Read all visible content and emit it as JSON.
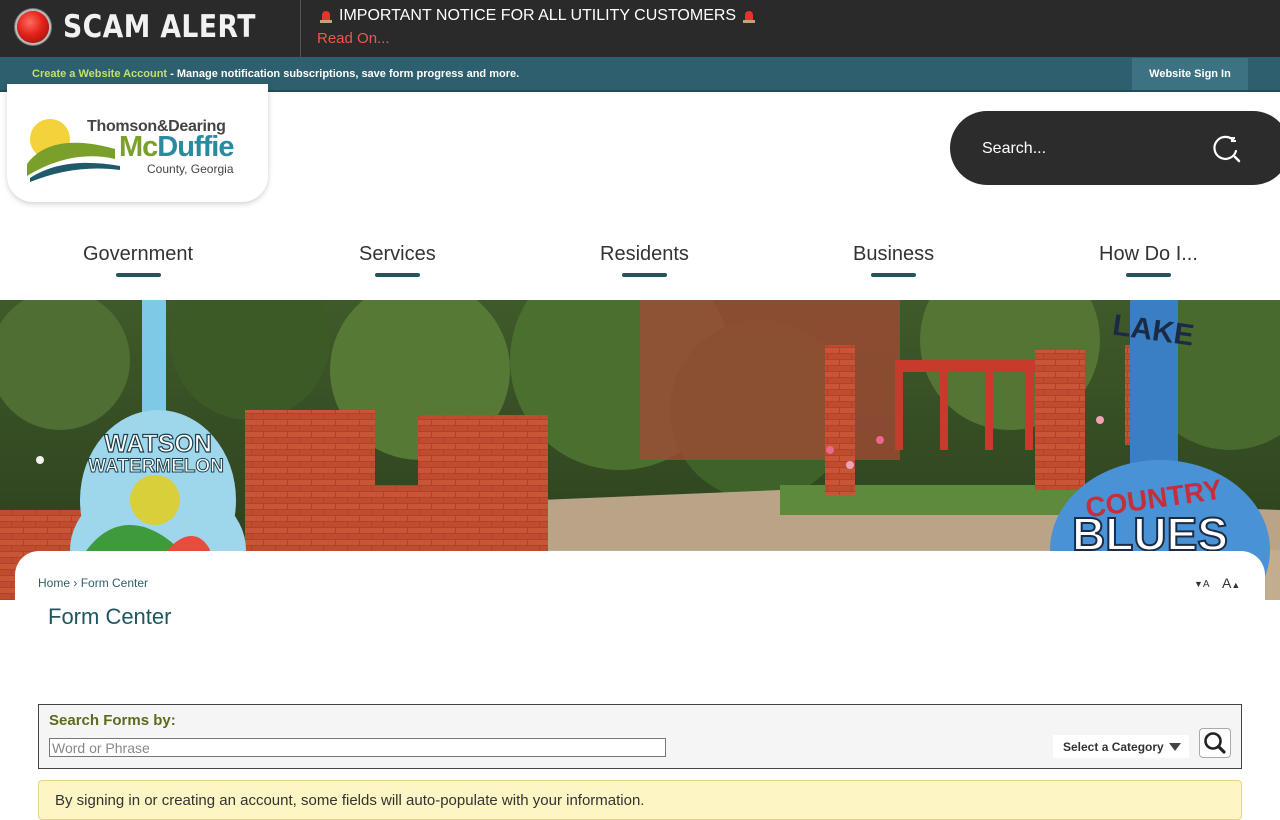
{
  "alert": {
    "title": "SCAM ALERT",
    "notice": "IMPORTANT NOTICE FOR ALL UTILITY CUSTOMERS",
    "read_on": "Read On..."
  },
  "account_bar": {
    "link": "Create a Website Account",
    "text": " - Manage notification subscriptions, save form progress and more.",
    "signin": "Website Sign In"
  },
  "logo": {
    "line1": "Thomson&Dearing",
    "line2_mc": "Mc",
    "line2_rest": "Duffie",
    "line3": "County, Georgia"
  },
  "search": {
    "placeholder": "Search..."
  },
  "nav": [
    {
      "label": "Government"
    },
    {
      "label": "Services"
    },
    {
      "label": "Residents"
    },
    {
      "label": "Business"
    },
    {
      "label": "How Do I..."
    }
  ],
  "banner": {
    "guitar_left_line1": "WATSON",
    "guitar_left_line2": "WATERMELON",
    "guitar_right_line1": "COUNTRY",
    "guitar_right_line2": "BLUES",
    "guitar_right_neck": "LAKE"
  },
  "breadcrumb": {
    "home": "Home",
    "sep": " › ",
    "current": "Form Center"
  },
  "font_controls": {
    "decrease": "A",
    "increase": "A"
  },
  "page_title": "Form Center",
  "form_search": {
    "label": "Search Forms by:",
    "placeholder": "Word or Phrase",
    "category": "Select a Category"
  },
  "notice": "By signing in or creating an account, some fields will auto-populate with your information.",
  "colors": {
    "alert_bg": "#2a2a2a",
    "alert_red": "#f1564a",
    "account_bar": "#2d5f6e",
    "accent_green": "#c2e06f",
    "nav_underline": "#20575f",
    "title": "#20575f",
    "notice_bg": "#fdf6c4"
  }
}
